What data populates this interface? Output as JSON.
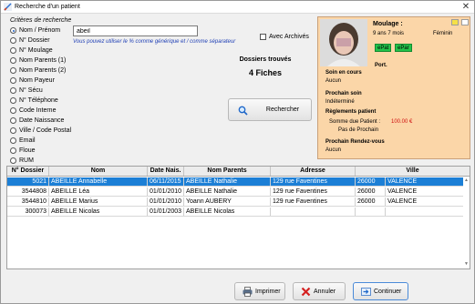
{
  "window": {
    "title": "Recherche d'un patient",
    "close_glyph": "✕"
  },
  "criteria": {
    "legend": "Critères de recherche",
    "options": [
      {
        "label": "Nom / Prénom",
        "checked": true
      },
      {
        "label": "N° Dossier",
        "checked": false
      },
      {
        "label": "N° Moulage",
        "checked": false
      },
      {
        "label": "Nom Parents (1)",
        "checked": false
      },
      {
        "label": "Nom Parents (2)",
        "checked": false
      },
      {
        "label": "Nom Payeur",
        "checked": false
      },
      {
        "label": "N° Sécu",
        "checked": false
      },
      {
        "label": "N° Téléphone",
        "checked": false
      },
      {
        "label": "Code Interne",
        "checked": false
      },
      {
        "label": "Date Naissance",
        "checked": false
      },
      {
        "label": "Ville / Code Postal",
        "checked": false
      },
      {
        "label": "Email",
        "checked": false
      },
      {
        "label": "Floue",
        "checked": false
      },
      {
        "label": "RUM",
        "checked": false
      }
    ]
  },
  "search": {
    "value": "abeil",
    "hint": "Vous pouvez utiliser le % comme générique et / comme séparateur"
  },
  "archives": {
    "label": "Avec Archivés",
    "checked": false
  },
  "results": {
    "title": "Dossiers trouvés",
    "count": "4 Fiches"
  },
  "search_button": {
    "label": "Rechercher",
    "icon": "magnifier-icon"
  },
  "patient": {
    "moulage_label": "Moulage :",
    "age": "9 ans 7 mois",
    "sexe": "Féminin",
    "tags": [
      "ePat",
      "ePar"
    ],
    "port_label": "Port.",
    "soin_title": "Soin en cours",
    "soin_value": "Aucun",
    "prochain_soin_title": "Prochain soin",
    "prochain_soin_value": "Indéterminé",
    "reglements_title": "Règlements patient",
    "somme_label": "Somme due Patient :",
    "somme_value": "100.00 €",
    "prochain_paiement": "Pas de Prochain",
    "rdv_title": "Prochain Rendez-vous",
    "rdv_value": "Aucun",
    "colors": {
      "panel": "#fbd6a8",
      "chip_yellow": "#f6e046",
      "chip_white": "#ffffff",
      "tag_green": "#22c24a"
    }
  },
  "table": {
    "headers": [
      "N° Dossier",
      "Nom",
      "Date Nais.",
      "Nom Parents",
      "Adresse",
      "Ville"
    ],
    "rows": [
      [
        "5021",
        "ABEILLE Annabelle",
        "06/11/2015",
        "ABEILLE Nathalie",
        "129 rue Faventines",
        "26000",
        "VALENCE"
      ],
      [
        "3544808",
        "ABEILLE Léa",
        "01/01/2010",
        "ABEILLE Nathalie",
        "129 rue Faventines",
        "26000",
        "VALENCE"
      ],
      [
        "3544810",
        "ABEILLE Marius",
        "01/01/2010",
        "Yoann AUBERY",
        "129 rue Faventines",
        "26000",
        "VALENCE"
      ],
      [
        "300073",
        "ABEILLE Nicolas",
        "01/01/2003",
        "ABEILLE Nicolas",
        "",
        "",
        ""
      ]
    ],
    "selected_row": 0,
    "colors": {
      "selected": "#1c7fd6"
    }
  },
  "buttons": {
    "print": "Imprimer",
    "cancel": "Annuler",
    "continue": "Continuer"
  }
}
